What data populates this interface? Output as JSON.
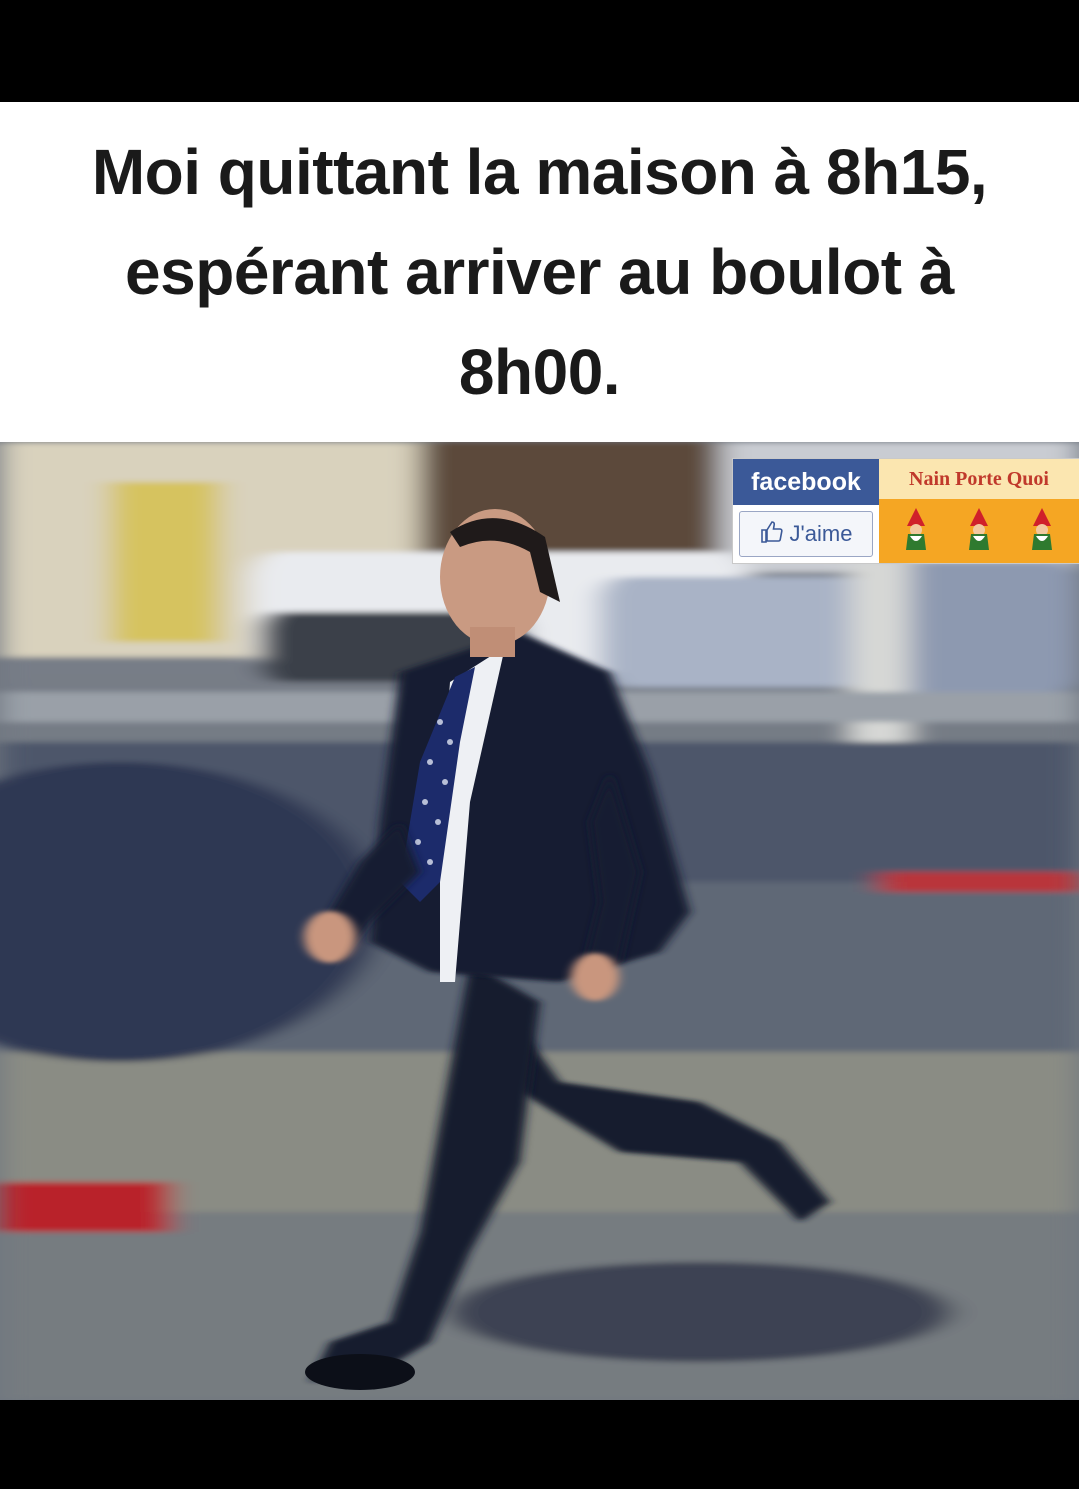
{
  "caption": {
    "text": "Moi quittant la maison à 8h15, espérant arriver au boulot à 8h00."
  },
  "watermark": {
    "network_label": "facebook",
    "like_label": "J'aime",
    "page_name": "Nain Porte Quoi",
    "colors": {
      "facebook_blue": "#3b5998",
      "badge_orange": "#f5a623",
      "page_name_red": "#c0392b"
    },
    "icons": [
      "thumbs-up-icon",
      "gnome-icon",
      "gnome-icon",
      "gnome-icon"
    ]
  },
  "photo": {
    "subject": "man-in-suit-running",
    "colors": {
      "suit": "#141a2e",
      "tie": "#1c2b6b",
      "shirt": "#eef0f4",
      "street": "#6c737c"
    }
  }
}
